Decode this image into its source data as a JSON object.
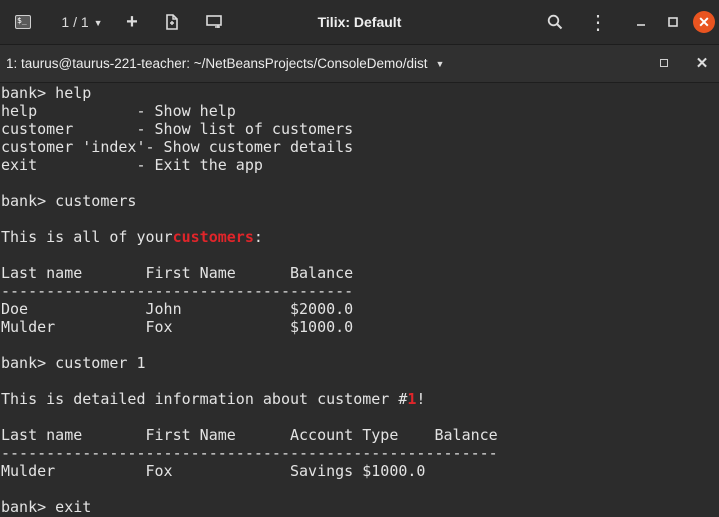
{
  "window": {
    "title": "Tilix: Default",
    "session_count": "1 / 1",
    "app_icon_text": "$_",
    "close_glyph": "✕",
    "menu_glyph": "⋮",
    "add_glyph": "+"
  },
  "session": {
    "title": "1: taurus@taurus-221-teacher: ~/NetBeansProjects/ConsoleDemo/dist",
    "close_glyph": "✕"
  },
  "colors": {
    "accent": "#e95420",
    "terminal_bg": "#2c2c2c",
    "highlight_red": "#e0252a"
  },
  "terminal": {
    "lines": [
      {
        "segments": [
          {
            "text": "bank> help"
          }
        ]
      },
      {
        "segments": [
          {
            "text": "help           - Show help"
          }
        ]
      },
      {
        "segments": [
          {
            "text": "customer       - Show list of customers"
          }
        ]
      },
      {
        "segments": [
          {
            "text": "customer 'index'- Show customer details"
          }
        ]
      },
      {
        "segments": [
          {
            "text": "exit           - Exit the app"
          }
        ]
      },
      {
        "segments": [
          {
            "text": ""
          }
        ]
      },
      {
        "segments": [
          {
            "text": "bank> customers"
          }
        ]
      },
      {
        "segments": [
          {
            "text": ""
          }
        ]
      },
      {
        "segments": [
          {
            "text": "This is all of your"
          },
          {
            "text": "customers",
            "style": "red"
          },
          {
            "text": ":"
          }
        ]
      },
      {
        "segments": [
          {
            "text": ""
          }
        ]
      },
      {
        "segments": [
          {
            "text": "Last name       First Name      Balance"
          }
        ]
      },
      {
        "segments": [
          {
            "text": "---------------------------------------"
          }
        ]
      },
      {
        "segments": [
          {
            "text": "Doe             John            $2000.0"
          }
        ]
      },
      {
        "segments": [
          {
            "text": "Mulder          Fox             $1000.0"
          }
        ]
      },
      {
        "segments": [
          {
            "text": ""
          }
        ]
      },
      {
        "segments": [
          {
            "text": "bank> customer 1"
          }
        ]
      },
      {
        "segments": [
          {
            "text": ""
          }
        ]
      },
      {
        "segments": [
          {
            "text": "This is detailed information about customer #"
          },
          {
            "text": "1",
            "style": "red"
          },
          {
            "text": "!"
          }
        ]
      },
      {
        "segments": [
          {
            "text": ""
          }
        ]
      },
      {
        "segments": [
          {
            "text": "Last name       First Name      Account Type    Balance"
          }
        ]
      },
      {
        "segments": [
          {
            "text": "-------------------------------------------------------"
          }
        ]
      },
      {
        "segments": [
          {
            "text": "Mulder          Fox             Savings $1000.0"
          }
        ]
      },
      {
        "segments": [
          {
            "text": ""
          }
        ]
      },
      {
        "segments": [
          {
            "text": "bank> exit"
          }
        ]
      }
    ]
  }
}
